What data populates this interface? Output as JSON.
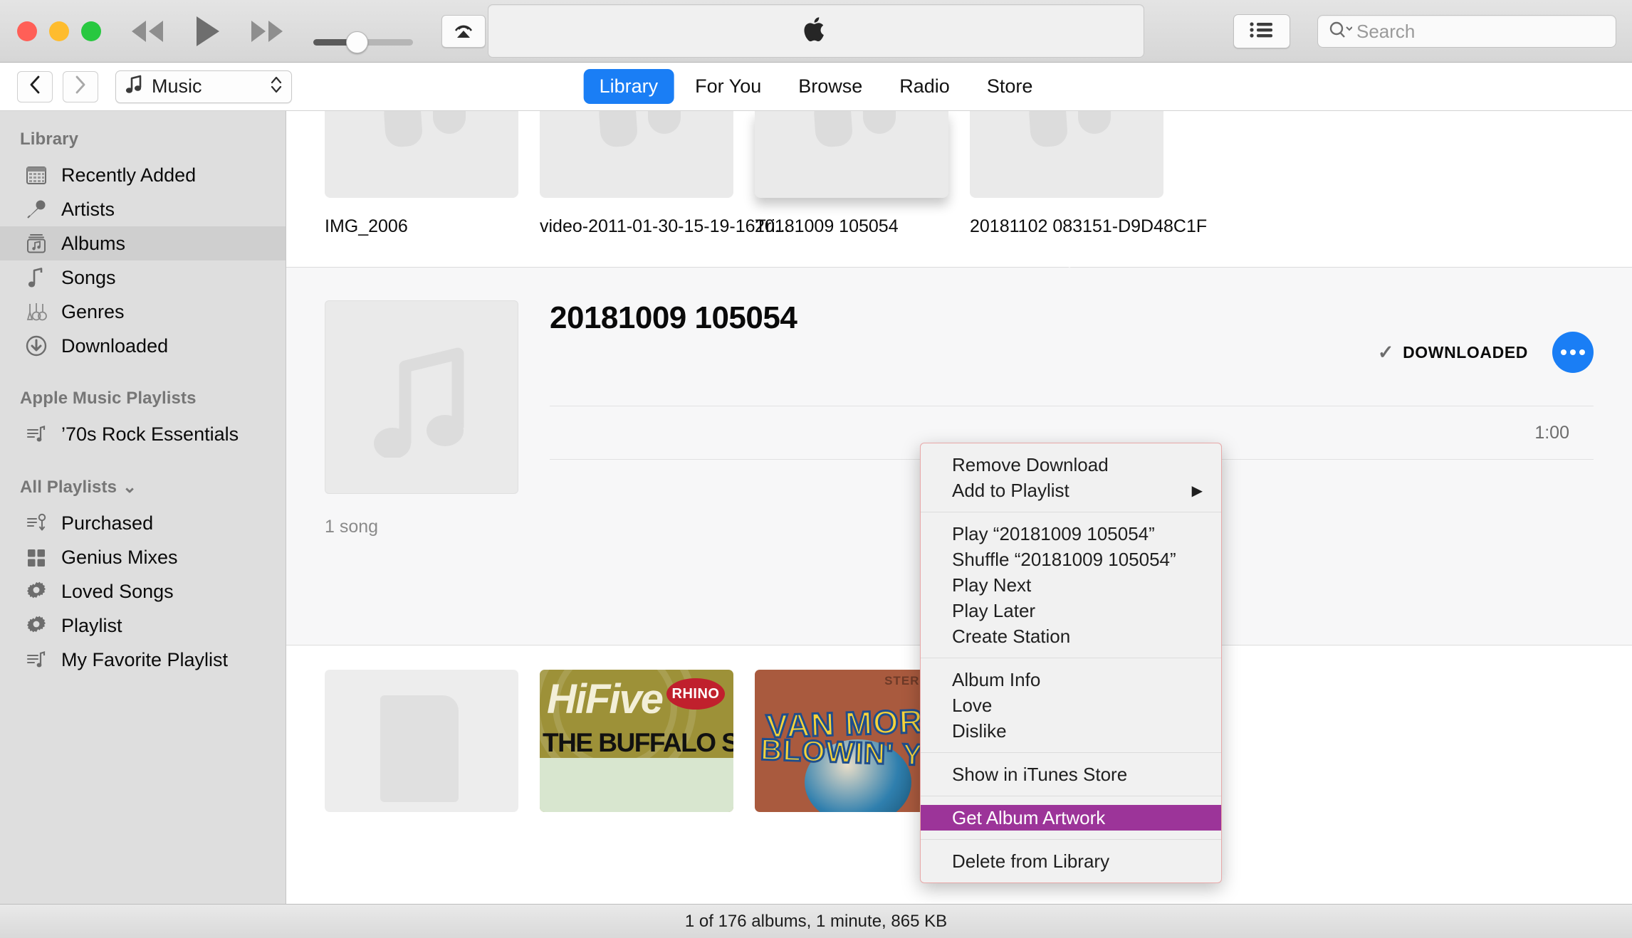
{
  "window": {
    "traffic_lights": [
      "close",
      "minimize",
      "maximize"
    ],
    "colors": {
      "accent_blue": "#1a7ef5",
      "menu_highlight": "#9c3499",
      "menu_border": "#e8a8a8"
    }
  },
  "toolbar": {
    "rewind_label": "Rewind",
    "play_label": "Play",
    "fastforward_label": "Fast Forward",
    "volume_value": 42,
    "airplay_label": "AirPlay",
    "apple_logo": "Apple",
    "list_view_label": "List View",
    "search": {
      "placeholder": "Search",
      "value": ""
    }
  },
  "navbar": {
    "back_label": "Back",
    "forward_label": "Forward",
    "source": {
      "label": "Music",
      "icon": "music-note-icon"
    },
    "tabs": [
      {
        "label": "Library",
        "active": true
      },
      {
        "label": "For You",
        "active": false
      },
      {
        "label": "Browse",
        "active": false
      },
      {
        "label": "Radio",
        "active": false
      },
      {
        "label": "Store",
        "active": false
      }
    ]
  },
  "sidebar": {
    "sections": [
      {
        "title": "Library",
        "items": [
          {
            "label": "Recently Added",
            "icon": "grid-calendar-icon",
            "selected": false
          },
          {
            "label": "Artists",
            "icon": "microphone-icon",
            "selected": false
          },
          {
            "label": "Albums",
            "icon": "album-stack-icon",
            "selected": true
          },
          {
            "label": "Songs",
            "icon": "music-note-icon",
            "selected": false
          },
          {
            "label": "Genres",
            "icon": "guitars-icon",
            "selected": false
          },
          {
            "label": "Downloaded",
            "icon": "download-circle-icon",
            "selected": false
          }
        ]
      },
      {
        "title": "Apple Music Playlists",
        "items": [
          {
            "label": "’70s Rock Essentials",
            "icon": "playlist-note-icon",
            "selected": false
          }
        ]
      },
      {
        "title": "All Playlists",
        "disclosure": "⌄",
        "items": [
          {
            "label": "Purchased",
            "icon": "playlist-download-icon",
            "selected": false
          },
          {
            "label": "Genius Mixes",
            "icon": "four-squares-icon",
            "selected": false
          },
          {
            "label": "Loved Songs",
            "icon": "gear-icon",
            "selected": false
          },
          {
            "label": "Playlist",
            "icon": "gear-icon",
            "selected": false
          },
          {
            "label": "My Favorite Playlist",
            "icon": "playlist-note-icon",
            "selected": false
          }
        ]
      }
    ]
  },
  "album_grid": {
    "top_row": [
      {
        "caption": "IMG_2006",
        "selected": false,
        "art": "placeholder"
      },
      {
        "caption": "video-2011-01-30-15-19-16Tri...",
        "selected": false,
        "art": "placeholder"
      },
      {
        "caption": "20181009 105054",
        "selected": true,
        "art": "placeholder"
      },
      {
        "caption": "20181102 083151-D9D48C1F",
        "selected": false,
        "art": "placeholder"
      }
    ],
    "bottom_row": [
      {
        "art": "placeholder",
        "caption": ""
      },
      {
        "art": "hifive",
        "title": "HiFive",
        "subtitle": "THE BUFFALO SPRINGFIELD",
        "badge": "RHINO"
      },
      {
        "art": "vanmorrison",
        "line1": "VAN MORRISON",
        "line2": "BLOWIN' YOUR MIND",
        "corner": "STEREO"
      },
      {
        "art": "supremes",
        "caption": ""
      }
    ]
  },
  "detail": {
    "title": "20181009 105054",
    "song_count": "1 song",
    "downloaded_label": "DOWNLOADED",
    "downloaded_check": "✓",
    "more_label": "More",
    "tracks": [
      {
        "name": "",
        "time": "1:00"
      }
    ]
  },
  "context_menu": {
    "groups": [
      {
        "items": [
          {
            "label": "Remove Download",
            "submenu": false,
            "highlight": false
          },
          {
            "label": "Add to Playlist",
            "submenu": true,
            "highlight": false
          }
        ]
      },
      {
        "items": [
          {
            "label": "Play “20181009 105054”",
            "submenu": false,
            "highlight": false
          },
          {
            "label": "Shuffle “20181009 105054”",
            "submenu": false,
            "highlight": false
          },
          {
            "label": "Play Next",
            "submenu": false,
            "highlight": false
          },
          {
            "label": "Play Later",
            "submenu": false,
            "highlight": false
          },
          {
            "label": "Create Station",
            "submenu": false,
            "highlight": false
          }
        ]
      },
      {
        "items": [
          {
            "label": "Album Info",
            "submenu": false,
            "highlight": false
          },
          {
            "label": "Love",
            "submenu": false,
            "highlight": false
          },
          {
            "label": "Dislike",
            "submenu": false,
            "highlight": false
          }
        ]
      },
      {
        "items": [
          {
            "label": "Show in iTunes Store",
            "submenu": false,
            "highlight": false
          }
        ]
      },
      {
        "items": [
          {
            "label": "Get Album Artwork",
            "submenu": false,
            "highlight": true
          }
        ]
      },
      {
        "items": [
          {
            "label": "Delete from Library",
            "submenu": false,
            "highlight": false
          }
        ]
      }
    ],
    "submenu_arrow": "▶"
  },
  "statusbar": {
    "text": "1 of 176 albums, 1 minute, 865 KB"
  }
}
